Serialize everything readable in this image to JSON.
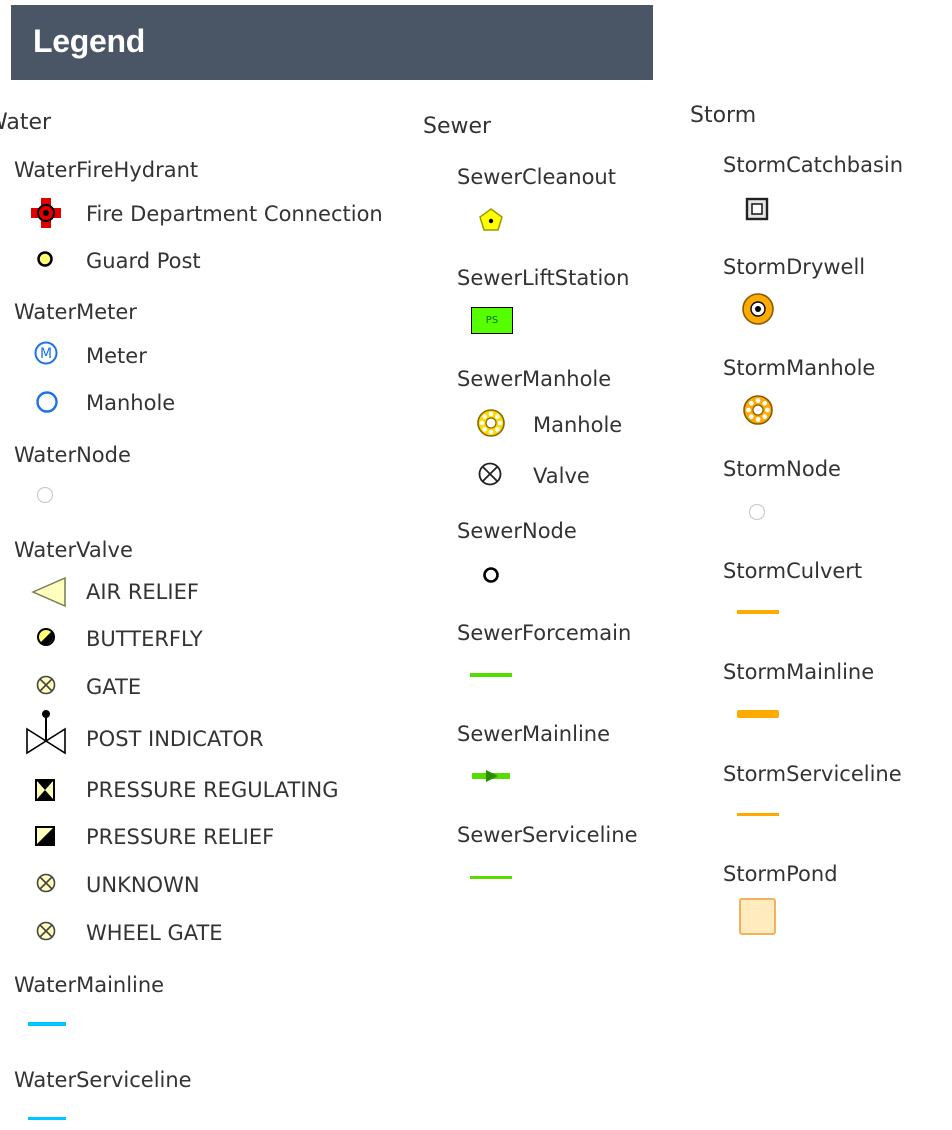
{
  "header": {
    "title": "Legend"
  },
  "groups": {
    "water": {
      "title": "Water",
      "layers": {
        "fire_hydrant": {
          "title": "WaterFireHydrant",
          "items": [
            "Fire Department Connection",
            "Guard Post"
          ],
          "icons": [
            "fire-department-connection-icon",
            "guard-post-icon"
          ]
        },
        "meter": {
          "title": "WaterMeter",
          "items": [
            "Meter",
            "Manhole"
          ],
          "icons": [
            "meter-icon",
            "manhole-icon"
          ]
        },
        "node": {
          "title": "WaterNode",
          "icon": "node-circle-icon"
        },
        "valve": {
          "title": "WaterValve",
          "items": [
            "AIR RELIEF",
            "BUTTERFLY",
            "GATE",
            "POST INDICATOR",
            "PRESSURE REGULATING",
            "PRESSURE RELIEF",
            "UNKNOWN",
            "WHEEL GATE"
          ]
        },
        "mainline": {
          "title": "WaterMainline",
          "color": "#00c5ff"
        },
        "serviceline": {
          "title": "WaterServiceline",
          "color": "#00c5ff"
        }
      }
    },
    "sewer": {
      "title": "Sewer",
      "layers": {
        "cleanout": {
          "title": "SewerCleanout",
          "color": "#ffff00"
        },
        "lift_station": {
          "title": "SewerLiftStation",
          "badge": "PS",
          "color": "#55ff00"
        },
        "manhole": {
          "title": "SewerManhole",
          "items": [
            "Manhole",
            "Valve"
          ]
        },
        "node": {
          "title": "SewerNode"
        },
        "forcemain": {
          "title": "SewerForcemain",
          "color": "#55dd00"
        },
        "mainline": {
          "title": "SewerMainline",
          "color": "#55dd00"
        },
        "serviceline": {
          "title": "SewerServiceline",
          "color": "#55dd00"
        }
      }
    },
    "storm": {
      "title": "Storm",
      "layers": {
        "catchbasin": {
          "title": "StormCatchbasin"
        },
        "drywell": {
          "title": "StormDrywell",
          "color": "#ffaa00"
        },
        "manhole": {
          "title": "StormManhole",
          "color": "#ffaa00"
        },
        "node": {
          "title": "StormNode"
        },
        "culvert": {
          "title": "StormCulvert",
          "color": "#ffaa00"
        },
        "mainline": {
          "title": "StormMainline",
          "color": "#ffaa00"
        },
        "serviceline": {
          "title": "StormServiceline",
          "color": "#ffaa00"
        },
        "pond": {
          "title": "StormPond",
          "color": "#ffebbe"
        }
      }
    }
  }
}
